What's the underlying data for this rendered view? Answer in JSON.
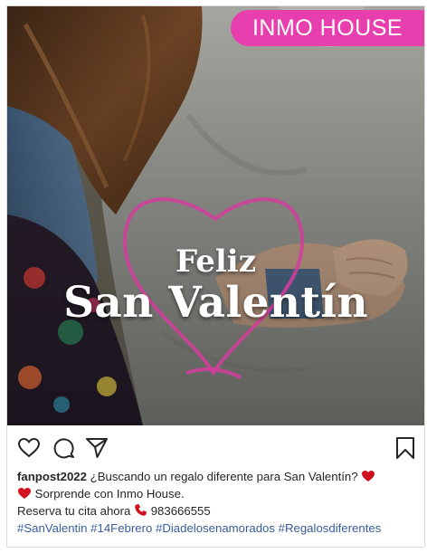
{
  "post": {
    "brand_banner": "INMO HOUSE",
    "title_line1": "Feliz",
    "title_line2": "San Valentín",
    "username": "fanpost2022",
    "caption_line1": "¿Buscando un regalo diferente para San Valentín?",
    "caption_line2": "Sorprende con Inmo House.",
    "caption_line3": "Reserva tu cita ahora",
    "phone": "983666555",
    "hashtags": [
      "#SanValentin",
      "#14Febrero",
      "#Diadelosenamorados",
      "#Regalosdiferentes"
    ]
  },
  "icons": {
    "like": "heart-outline-icon",
    "comment": "comment-bubble-icon",
    "share": "paper-plane-icon",
    "save": "bookmark-icon",
    "emoji_heart": "red-heart-icon",
    "emoji_phone": "telephone-icon"
  },
  "colors": {
    "brand_pink": "#e83fae",
    "heart_pink": "#d43d9c",
    "hashtag_blue": "#385e9d",
    "emoji_red": "#d0101e",
    "text": "#262626"
  }
}
